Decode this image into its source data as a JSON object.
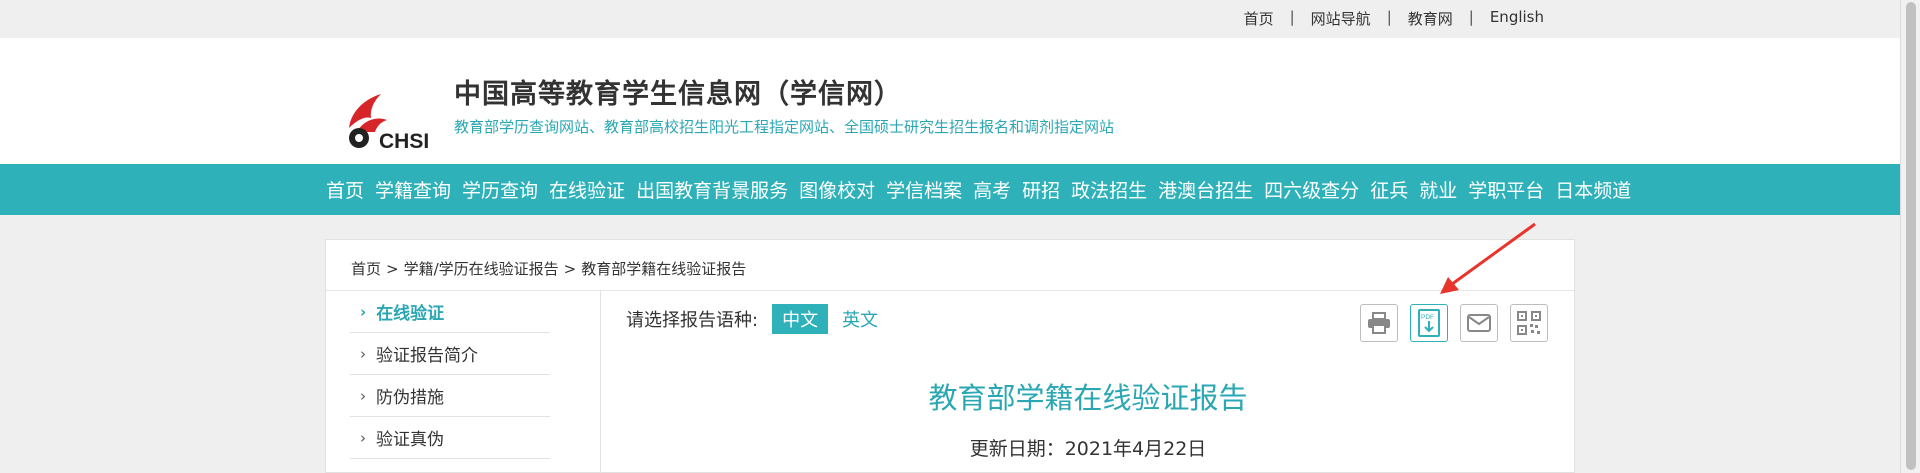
{
  "top_links": [
    "首页",
    "网站导航",
    "教育网",
    "English"
  ],
  "top_sep": "|",
  "header": {
    "logo_text": "CHSI",
    "title": "中国高等教育学生信息网（学信网）",
    "subtitle": "教育部学历查询网站、教育部高校招生阳光工程指定网站、全国硕士研究生招生报名和调剂指定网站"
  },
  "nav": [
    "首页",
    "学籍查询",
    "学历查询",
    "在线验证",
    "出国教育背景服务",
    "图像校对",
    "学信档案",
    "高考",
    "研招",
    "政法招生",
    "港澳台招生",
    "四六级查分",
    "征兵",
    "就业",
    "学职平台",
    "日本频道"
  ],
  "breadcrumb": [
    "首页",
    "学籍/学历在线验证报告",
    "教育部学籍在线验证报告"
  ],
  "breadcrumb_sep": ">",
  "sidebar": [
    {
      "label": "在线验证",
      "active": true
    },
    {
      "label": "验证报告简介",
      "active": false
    },
    {
      "label": "防伪措施",
      "active": false
    },
    {
      "label": "验证真伪",
      "active": false
    }
  ],
  "sidebar_arrow": "›",
  "language": {
    "label": "请选择报告语种:",
    "options": [
      "中文",
      "英文"
    ],
    "selected": "中文"
  },
  "tools": [
    {
      "name": "print-icon"
    },
    {
      "name": "pdf-download-icon"
    },
    {
      "name": "email-icon"
    },
    {
      "name": "qrcode-icon"
    }
  ],
  "pdf_icon_text": "PDF",
  "report": {
    "title": "教育部学籍在线验证报告",
    "date": "更新日期：2021年4月22日"
  },
  "colors": {
    "accent": "#2fb1ba",
    "annotation_arrow": "#e8342b",
    "logo_red": "#d7262a"
  }
}
